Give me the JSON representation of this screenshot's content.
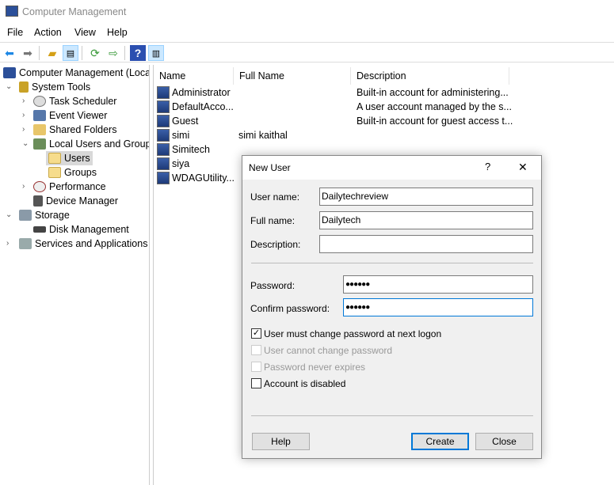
{
  "window": {
    "title": "Computer Management"
  },
  "menu": [
    "File",
    "Action",
    "View",
    "Help"
  ],
  "tree": [
    {
      "label": "Computer Management (Local",
      "level": 0,
      "expander": ""
    },
    {
      "label": "System Tools",
      "level": 1,
      "expander": "expanded"
    },
    {
      "label": "Task Scheduler",
      "level": 2,
      "expander": "collapsed"
    },
    {
      "label": "Event Viewer",
      "level": 2,
      "expander": "collapsed"
    },
    {
      "label": "Shared Folders",
      "level": 2,
      "expander": "collapsed"
    },
    {
      "label": "Local Users and Groups",
      "level": 2,
      "expander": "expanded"
    },
    {
      "label": "Users",
      "level": 3,
      "expander": "",
      "selected": true
    },
    {
      "label": "Groups",
      "level": 3,
      "expander": ""
    },
    {
      "label": "Performance",
      "level": 2,
      "expander": "collapsed"
    },
    {
      "label": "Device Manager",
      "level": 2,
      "expander": ""
    },
    {
      "label": "Storage",
      "level": 1,
      "expander": "expanded"
    },
    {
      "label": "Disk Management",
      "level": 2,
      "expander": ""
    },
    {
      "label": "Services and Applications",
      "level": 1,
      "expander": "collapsed"
    }
  ],
  "list": {
    "columns": [
      "Name",
      "Full Name",
      "Description"
    ],
    "rows": [
      {
        "name": "Administrator",
        "full_name": "",
        "description": "Built-in account for administering..."
      },
      {
        "name": "DefaultAcco...",
        "full_name": "",
        "description": "A user account managed by the s..."
      },
      {
        "name": "Guest",
        "full_name": "",
        "description": "Built-in account for guest access t..."
      },
      {
        "name": "simi",
        "full_name": "simi kaithal",
        "description": ""
      },
      {
        "name": "Simitech",
        "full_name": "",
        "description": ""
      },
      {
        "name": "siya",
        "full_name": "",
        "description": ""
      },
      {
        "name": "WDAGUtility...",
        "full_name": "",
        "description": ""
      }
    ]
  },
  "dialog": {
    "title": "New User",
    "help_glyph": "?",
    "close_glyph": "✕",
    "user_name_label": "User name:",
    "user_name": "Dailytechreview",
    "full_name_label": "Full name:",
    "full_name": "Dailytech",
    "description_label": "Description:",
    "description": "",
    "password_label": "Password:",
    "password": "●●●●●●",
    "confirm_label": "Confirm password:",
    "confirm": "●●●●●●",
    "checkboxes": [
      {
        "label": "User must change password at next logon",
        "checked": true,
        "enabled": true
      },
      {
        "label": "User cannot change password",
        "checked": false,
        "enabled": false
      },
      {
        "label": "Password never expires",
        "checked": false,
        "enabled": false
      },
      {
        "label": "Account is disabled",
        "checked": false,
        "enabled": true
      }
    ],
    "help_button": "Help",
    "create_button": "Create",
    "close_button": "Close"
  },
  "colors": {
    "accent": "#0078d7",
    "selection": "#d9d9d9",
    "dialog_bg": "#f0f0f0"
  }
}
